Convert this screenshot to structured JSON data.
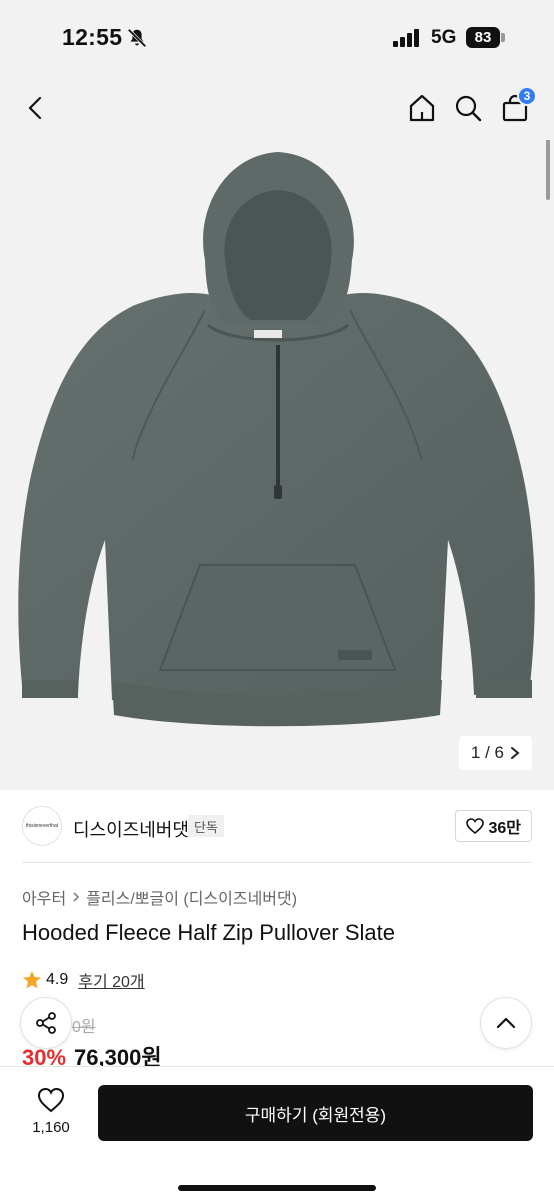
{
  "status_bar": {
    "time": "12:55",
    "network": "5G",
    "battery": "83"
  },
  "nav": {
    "cart_count": "3"
  },
  "image": {
    "counter": "1 / 6"
  },
  "brand": {
    "logo_text": "thisisneverthat",
    "name": "디스이즈네버댓",
    "tag": "단독",
    "likes": "36만"
  },
  "product": {
    "breadcrumb": [
      "아우터",
      "플리스/뽀글이 (디스이즈네버댓)"
    ],
    "title": "Hooded Fleece Half Zip Pullover Slate",
    "rating": "4.9",
    "review_link": "후기 20개",
    "original_price": "0원",
    "discount": "30%",
    "price": "76,300원"
  },
  "bottom": {
    "wish_count": "1,160",
    "buy_label": "구매하기 (회원전용)"
  },
  "colors": {
    "badge": "#2f7cf6",
    "discount": "#e62e2e",
    "star": "#f5a623",
    "garment": "#5a6664"
  }
}
